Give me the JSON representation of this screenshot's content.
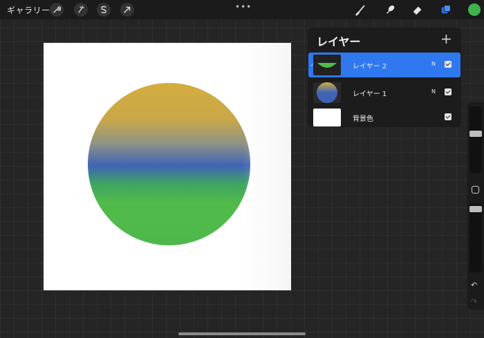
{
  "toolbar": {
    "gallery_label": "ギャラリー",
    "more_label": "•••",
    "left_tools": [
      "actions-icon",
      "adjustments-icon",
      "selection-icon",
      "transform-icon"
    ],
    "right_tools": [
      "brush-icon",
      "smudge-icon",
      "eraser-icon",
      "layers-icon"
    ],
    "current_color": "#3fb24b"
  },
  "layers_panel": {
    "title": "レイヤー",
    "add_label": "+",
    "layers": [
      {
        "name": "レイヤー 2",
        "blend_mode": "N",
        "visible": true,
        "selected": true
      },
      {
        "name": "レイヤー 1",
        "blend_mode": "N",
        "visible": true,
        "selected": false
      },
      {
        "name": "背景色",
        "visible": true,
        "selected": false
      }
    ],
    "active_color": "#2f78f0"
  },
  "sidebar": {
    "undo_icon": "undo-icon",
    "redo_icon": "redo-icon"
  },
  "canvas": {
    "background": "#ffffff",
    "gradient_colors": [
      "#d3ad3f",
      "#3f64b7",
      "#51bb4a"
    ]
  }
}
